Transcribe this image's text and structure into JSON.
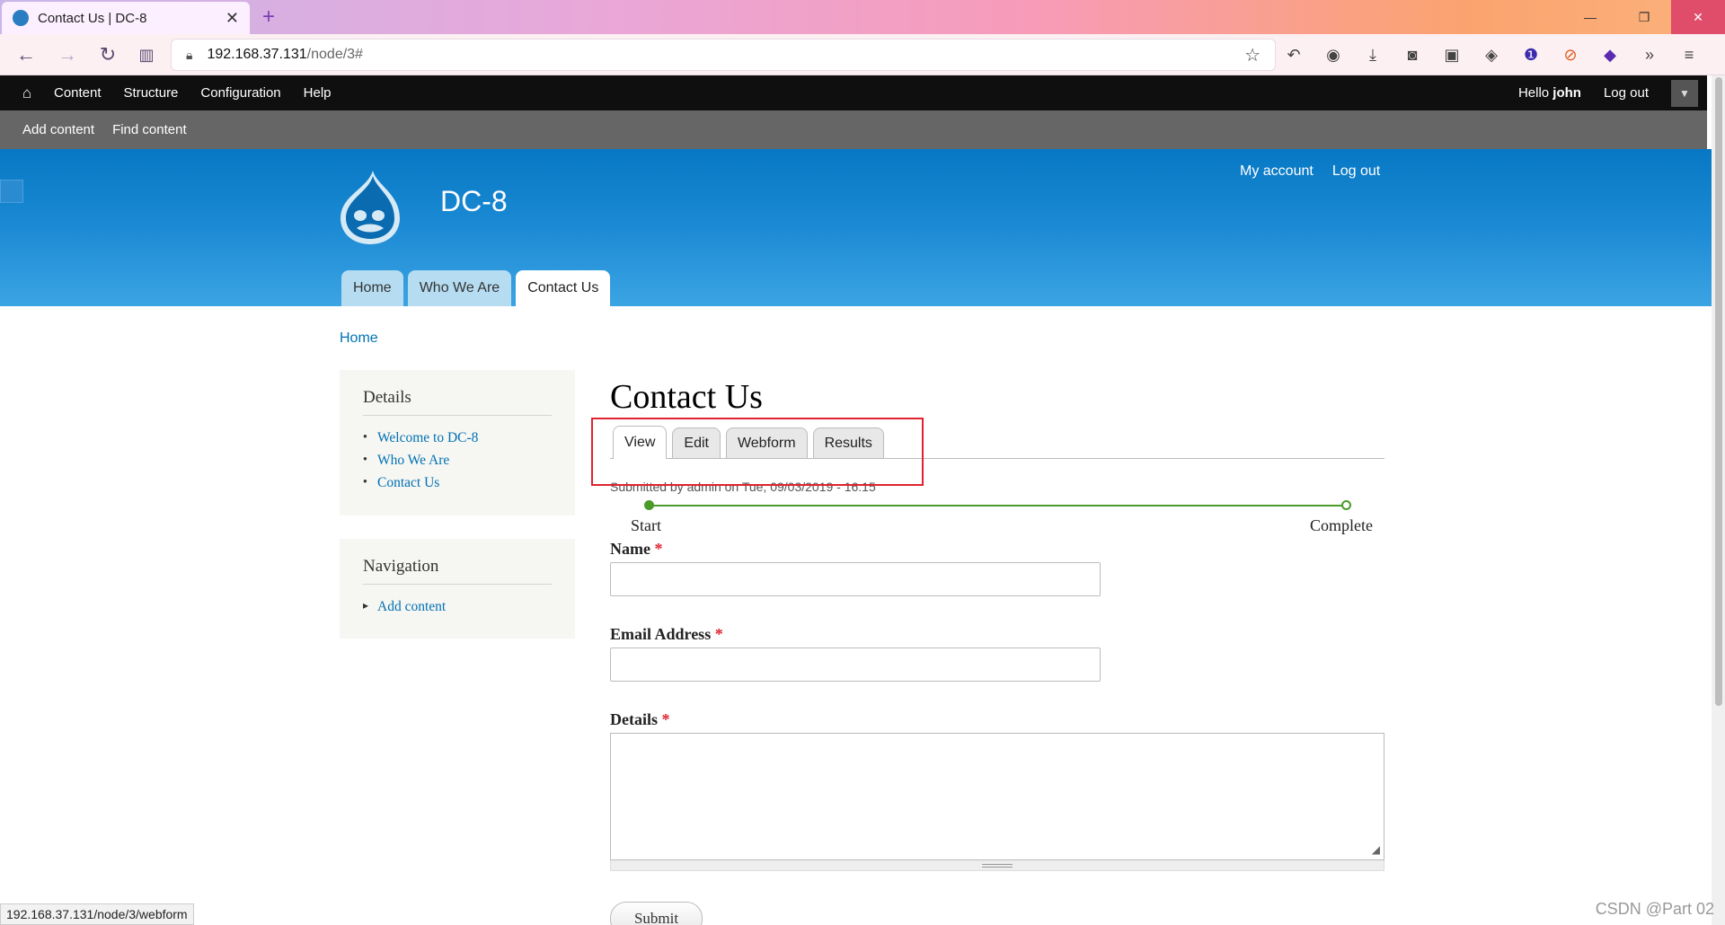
{
  "browser": {
    "tab_title": "Contact Us | DC-8",
    "tab_close": "✕",
    "new_tab": "+",
    "url_host": "192.168.37.131",
    "url_path": "/node/3#",
    "win_min": "—",
    "win_restore": "❐",
    "win_close": "✕"
  },
  "toolbar": {
    "items": [
      "Content",
      "Structure",
      "Configuration",
      "Help"
    ],
    "hello": "Hello ",
    "username": "john",
    "logout": "Log out"
  },
  "shortcuts": [
    "Add content",
    "Find content"
  ],
  "header": {
    "site_name": "DC-8",
    "secondary": [
      "My account",
      "Log out"
    ],
    "menu": [
      "Home",
      "Who We Are",
      "Contact Us"
    ]
  },
  "breadcrumb": "Home",
  "sidebar": {
    "details": {
      "title": "Details",
      "items": [
        "Welcome to DC-8",
        "Who We Are",
        "Contact Us"
      ]
    },
    "navigation": {
      "title": "Navigation",
      "items": [
        "Add content"
      ]
    }
  },
  "main": {
    "title": "Contact Us",
    "tabs": [
      "View",
      "Edit",
      "Webform",
      "Results"
    ],
    "submitted": "Submitted by admin on Tue, 09/03/2019 - 16:15",
    "progress": {
      "start": "Start",
      "end": "Complete"
    },
    "fields": {
      "name": "Name",
      "email": "Email Address",
      "details": "Details",
      "required": "*"
    },
    "submit": "Submit"
  },
  "status_url": "192.168.37.131/node/3/webform",
  "watermark": "CSDN @Part 02"
}
